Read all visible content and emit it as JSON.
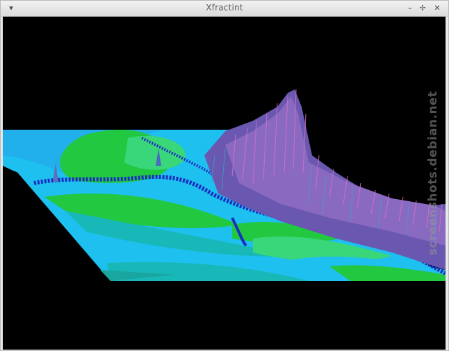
{
  "window": {
    "title": "Xfractint",
    "menu_icon": "window-menu-icon",
    "minimize_icon": "minimize-icon",
    "maximize_icon": "maximize-icon",
    "close_icon": "close-icon"
  },
  "watermark": "screenshots.debian.net",
  "colors": {
    "background": "#000000",
    "cyan": "#1ec0f0",
    "teal": "#19b8b8",
    "green": "#22c840",
    "light_green": "#3ad67a",
    "blue": "#1a2ec0",
    "purple": "#7a5ab8",
    "pink": "#d070c8"
  }
}
